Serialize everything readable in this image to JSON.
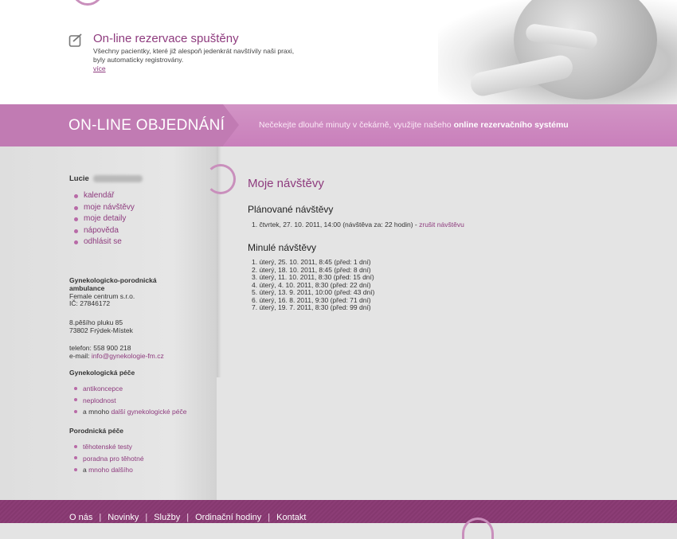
{
  "news": {
    "title": "On-line rezervace spuštěny",
    "text_line1": "Všechny pacientky, které již alespoň jedenkrát navštívily naši praxi,",
    "text_line2": "byly automaticky registrovány.",
    "more": "více"
  },
  "band": {
    "title": "ON-LINE OBJEDNÁNÍ",
    "slogan": "Nečekejte dlouhé minuty v čekárně, využijte našeho ",
    "slogan_strong": "online rezervačního systému"
  },
  "user": {
    "first_name": "Lucie"
  },
  "menu": [
    {
      "label": "kalendář"
    },
    {
      "label": "moje návštěvy"
    },
    {
      "label": "moje detaily"
    },
    {
      "label": "nápověda"
    },
    {
      "label": "odhlásit se"
    }
  ],
  "clinic": {
    "name_line1": "Gynekologicko-porodnická",
    "name_line2": "ambulance",
    "company": "Female centrum s.r.o.",
    "ic": "IČ: 27846172",
    "street": "8.pěšího pluku 85",
    "city": "73802 Frýdek-Místek",
    "phone": "telefon: 558 900 218",
    "email_label": "e-mail: ",
    "email": "info@gynekologie-fm.cz"
  },
  "gyn_care": {
    "title": "Gynekologická péče",
    "items": [
      "antikoncepce",
      "neplodnost"
    ],
    "more_prefix": "a mnoho ",
    "more_link": "další gynekologické péče"
  },
  "obs_care": {
    "title": "Porodnická péče",
    "items": [
      "těhotenské testy",
      "poradna pro těhotné"
    ],
    "more_prefix": "a ",
    "more_link": "mnoho dalšího"
  },
  "main": {
    "title": "Moje návštěvy",
    "planned_title": "Plánované návštěvy",
    "planned": [
      {
        "text": "1.  čtvrtek, 27. 10. 2011, 14:00 (návštěva za: 22 hodin) - ",
        "action": "zrušit návštěvu"
      }
    ],
    "past_title": "Minulé návštěvy",
    "past": [
      "1.  úterý, 25. 10. 2011, 8:45 (před: 1 dní)",
      "2.  úterý, 18. 10. 2011, 8:45 (před: 8 dní)",
      "3.  úterý, 11. 10. 2011, 8:30 (před: 15 dní)",
      "4.  úterý, 4. 10. 2011, 8:30 (před: 22 dní)",
      "5.  úterý, 13. 9. 2011, 10:00 (před: 43 dní)",
      "6.  úterý, 16. 8. 2011, 9:30 (před: 71 dní)",
      "7.  úterý, 19. 7. 2011, 8:30 (před: 99 dní)"
    ]
  },
  "footer": {
    "links": [
      "O nás",
      "Novinky",
      "Služby",
      "Ordinační hodiny",
      "Kontakt"
    ]
  },
  "colors": {
    "accent": "#8e3b7e",
    "band": "#c97fbb",
    "footer": "#85386f"
  }
}
